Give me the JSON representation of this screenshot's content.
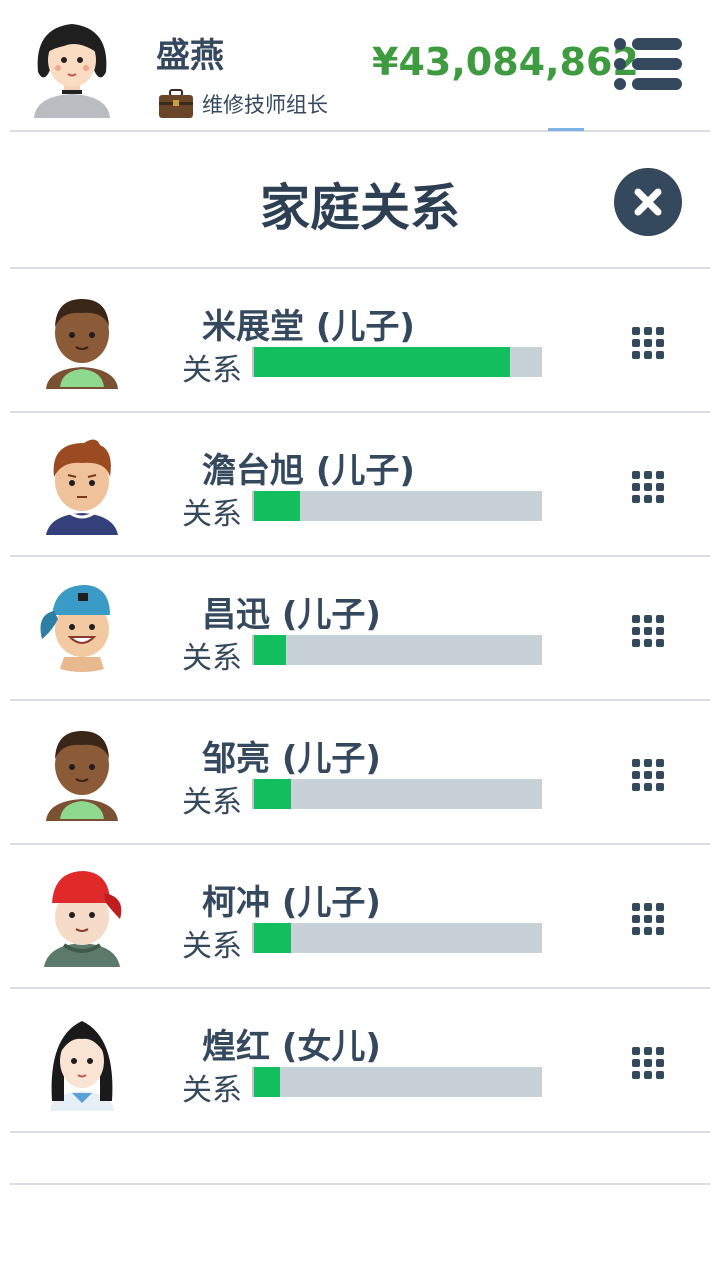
{
  "header": {
    "player_name": "盛燕",
    "job_title": "维修技师组长",
    "money": "¥43,084,862",
    "icons": {
      "avatar": "avatar-icon",
      "job": "briefcase-icon",
      "menu": "menu-icon"
    }
  },
  "panel": {
    "title": "家庭关系",
    "close_icon": "close-icon"
  },
  "members": [
    {
      "name": "米展堂 (儿子)",
      "relation_label": "关系",
      "relation_level": 0.89,
      "avatar": "boy-dark-skin-avatar"
    },
    {
      "name": "澹台旭 (儿子)",
      "relation_label": "关系",
      "relation_level": 0.16,
      "avatar": "boy-brown-hair-avatar"
    },
    {
      "name": "昌迅 (儿子)",
      "relation_label": "关系",
      "relation_level": 0.11,
      "avatar": "boy-blue-cap-avatar"
    },
    {
      "name": "邹亮 (儿子)",
      "relation_label": "关系",
      "relation_level": 0.13,
      "avatar": "boy-dark-skin-avatar"
    },
    {
      "name": "柯冲 (儿子)",
      "relation_label": "关系",
      "relation_level": 0.13,
      "avatar": "boy-red-cap-avatar"
    },
    {
      "name": "煌红 (女儿)",
      "relation_label": "关系",
      "relation_level": 0.09,
      "avatar": "girl-black-hair-avatar"
    }
  ],
  "colors": {
    "money": "#3e9b3f",
    "relation_fill": "#13bf5d",
    "relation_track": "#c9d1d8",
    "text": "#34495e"
  }
}
